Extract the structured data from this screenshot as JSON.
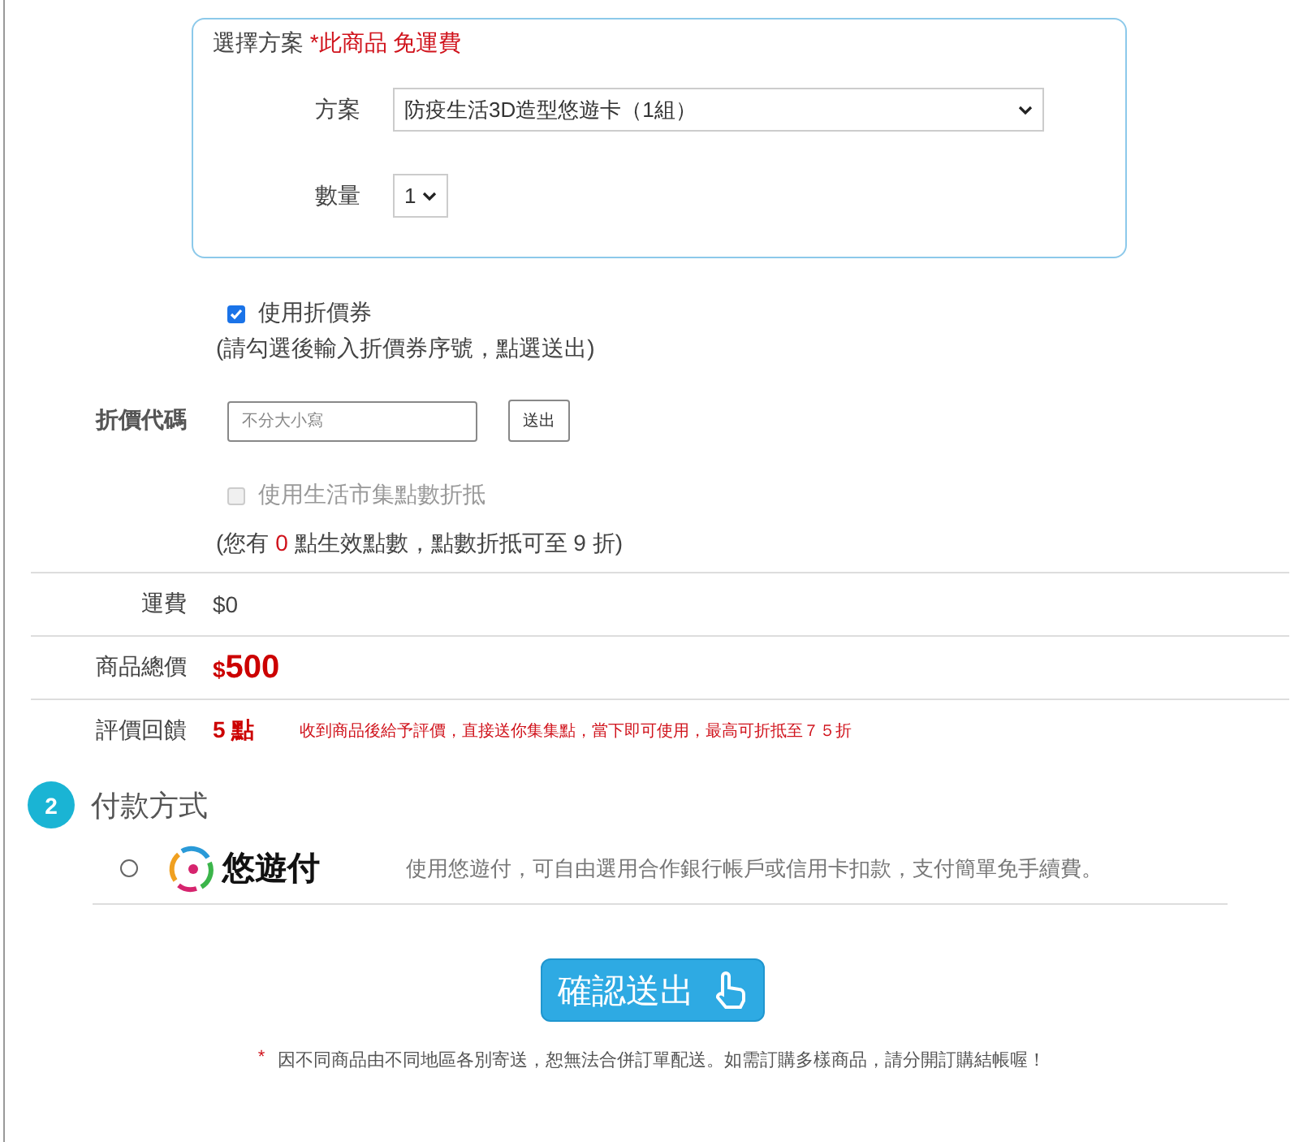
{
  "plan_box": {
    "title": "選擇方案",
    "note": "*此商品 免運費",
    "fields": [
      {
        "label": "方案",
        "value": "防疫生活3D造型悠遊卡（1組）",
        "kind": "wide"
      },
      {
        "label": "數量",
        "value": "1",
        "kind": "narrow"
      }
    ]
  },
  "coupon": {
    "checked": true,
    "label": "使用折價券",
    "hint": "(請勾選後輸入折價券序號，點選送出)"
  },
  "coupon_code": {
    "label": "折價代碼",
    "placeholder": "不分大小寫",
    "button": "送出"
  },
  "points": {
    "checked": false,
    "disabled": true,
    "label": "使用生活市集點數折抵",
    "hint_before": "(您有",
    "count": "0",
    "hint_after": "點生效點數，點數折抵可至 9 折)"
  },
  "summary": [
    {
      "kind": "plain",
      "label": "運費",
      "value": "$0"
    },
    {
      "kind": "price",
      "label": "商品總價",
      "currency": "$",
      "value": "500"
    },
    {
      "kind": "points",
      "label": "評價回饋",
      "value": "5 點",
      "note": "收到商品後給予評價，直接送你集集點，當下即可使用，最高可折抵至７５折"
    }
  ],
  "payment": {
    "step": "2",
    "title": "付款方式",
    "options": [
      {
        "selected": false,
        "brand": "悠遊付",
        "description": "使用悠遊付，可自由選用合作銀行帳戶或信用卡扣款，支付簡單免手續費。"
      }
    ]
  },
  "submit": "確認送出",
  "footnote": {
    "mark": "*",
    "text": "因不同商品由不同地區各別寄送，恕無法合併訂單配送。如需訂購多樣商品，請分開訂購結帳喔！"
  }
}
